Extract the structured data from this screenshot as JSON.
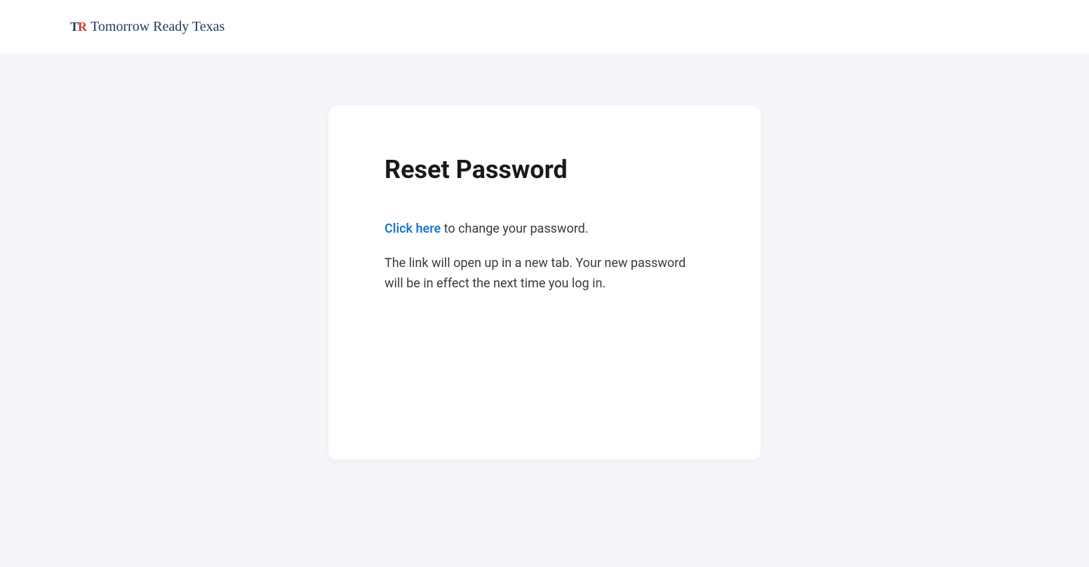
{
  "header": {
    "logo_initials_t": "T",
    "logo_initials_r": "R",
    "logo_text": "Tomorrow Ready Texas"
  },
  "card": {
    "title": "Reset Password",
    "link_text": "Click here",
    "link_suffix": " to change your password.",
    "description": "The link will open up in a new tab. Your new password will be in effect the next time you log in."
  }
}
